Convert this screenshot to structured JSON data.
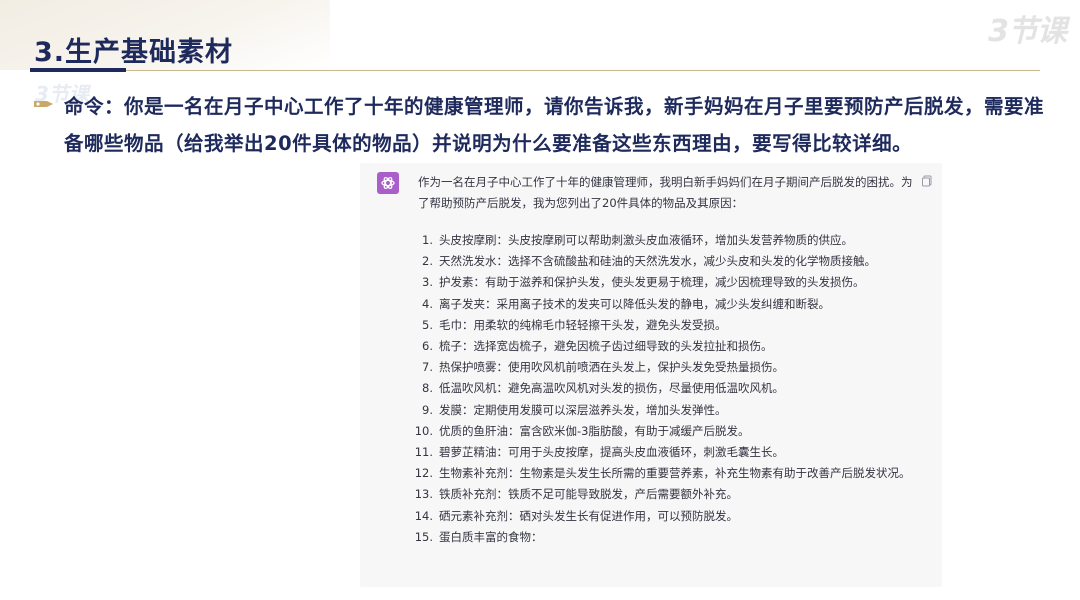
{
  "slide": {
    "title": "3.生产基础素材",
    "logo_text": "3节课",
    "watermark_text": "3节课"
  },
  "prompt": {
    "label": "命令：",
    "text": "你是一名在月子中心工作了十年的健康管理师，请你告诉我，新手妈妈在月子里要预防产后脱发，需要准备哪些物品（给我举出20件具体的物品）并说明为什么要准备这些东西理由，要写得比较详细。"
  },
  "chat": {
    "avatar_icon": "chatgpt-logo-icon",
    "avatar_color": "#a95ec9",
    "intro": "作为一名在月子中心工作了十年的健康管理师，我明白新手妈妈们在月子期间产后脱发的困扰。为了帮助预防产后脱发，我为您列出了20件具体的物品及其原因：",
    "items": [
      {
        "num": "1.",
        "text": "头皮按摩刷：头皮按摩刷可以帮助刺激头皮血液循环，增加头发营养物质的供应。"
      },
      {
        "num": "2.",
        "text": "天然洗发水：选择不含硫酸盐和硅油的天然洗发水，减少头皮和头发的化学物质接触。"
      },
      {
        "num": "3.",
        "text": "护发素：有助于滋养和保护头发，使头发更易于梳理，减少因梳理导致的头发损伤。"
      },
      {
        "num": "4.",
        "text": "离子发夹：采用离子技术的发夹可以降低头发的静电，减少头发纠缠和断裂。"
      },
      {
        "num": "5.",
        "text": "毛巾：用柔软的纯棉毛巾轻轻擦干头发，避免头发受损。"
      },
      {
        "num": "6.",
        "text": "梳子：选择宽齿梳子，避免因梳子齿过细导致的头发拉扯和损伤。"
      },
      {
        "num": "7.",
        "text": "热保护喷雾：使用吹风机前喷洒在头发上，保护头发免受热量损伤。"
      },
      {
        "num": "8.",
        "text": "低温吹风机：避免高温吹风机对头发的损伤，尽量使用低温吹风机。"
      },
      {
        "num": "9.",
        "text": "发膜：定期使用发膜可以深层滋养头发，增加头发弹性。"
      },
      {
        "num": "10.",
        "text": "优质的鱼肝油：富含欧米伽-3脂肪酸，有助于减缓产后脱发。"
      },
      {
        "num": "11.",
        "text": "碧萝芷精油：可用于头皮按摩，提高头皮血液循环，刺激毛囊生长。"
      },
      {
        "num": "12.",
        "text": "生物素补充剂：生物素是头发生长所需的重要营养素，补充生物素有助于改善产后脱发状况。"
      },
      {
        "num": "13.",
        "text": "铁质补充剂：铁质不足可能导致脱发，产后需要额外补充。"
      },
      {
        "num": "14.",
        "text": "硒元素补充剂：硒对头发生长有促进作用，可以预防脱发。"
      },
      {
        "num": "15.",
        "text": "蛋白质丰富的食物："
      }
    ]
  }
}
